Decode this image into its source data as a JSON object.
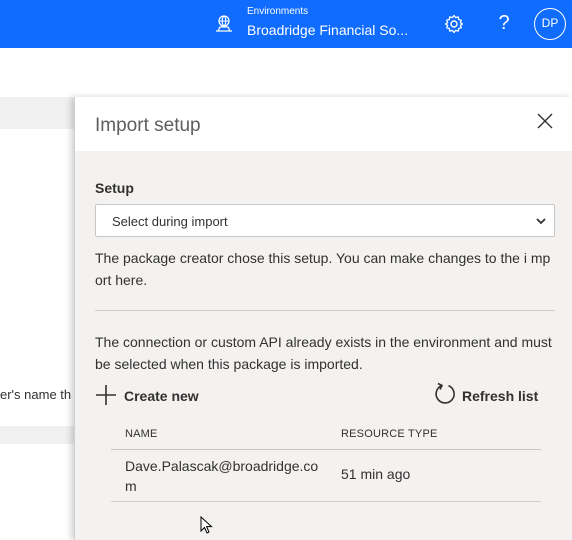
{
  "topbar": {
    "environment_label": "Environments",
    "environment_name": "Broadridge Financial So...",
    "help_glyph": "?",
    "avatar_initials": "DP",
    "background_color": "#0f6cff"
  },
  "background_page": {
    "truncated_text": "er's name th"
  },
  "panel": {
    "title": "Import setup",
    "setup_label": "Setup",
    "setup_select": {
      "value": "Select during import"
    },
    "setup_description": "The package creator chose this setup. You can make changes to the i mport here.",
    "connection_description": "The connection or custom API already exists in the environment and must be selected when this package is imported.",
    "create_new_label": "Create new",
    "refresh_label": "Refresh list",
    "table": {
      "columns": [
        "NAME",
        "RESOURCE TYPE"
      ],
      "rows": [
        {
          "name": "Dave.Palascak@broadridge.com",
          "type": "51 min ago"
        }
      ]
    }
  },
  "icons": {
    "environment": "environment-globe-icon",
    "settings": "gear-icon",
    "help": "question-icon",
    "close": "close-icon",
    "add": "plus-icon",
    "refresh": "refresh-icon",
    "dropdown": "chevron-down-icon"
  }
}
